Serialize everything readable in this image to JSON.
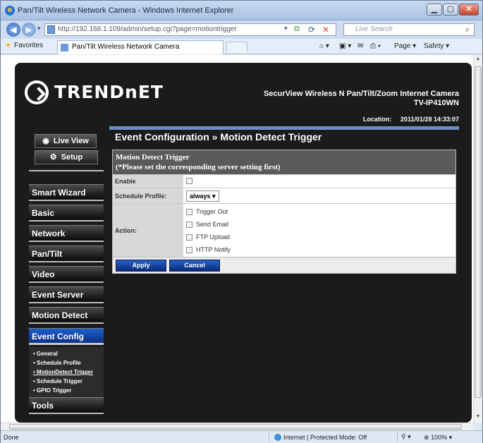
{
  "window": {
    "title": "Pan/Tilt Wireless Network Camera - Windows Internet Explorer",
    "minimize": "▁",
    "maximize": "▢",
    "close": "✕"
  },
  "addressbar": {
    "url": "http://192.168.1.109/admin/setup.cgi?page=motiontrigger",
    "search_placeholder": "Live Search"
  },
  "favorites": {
    "label": "Favorites",
    "tab_title": "Pan/Tilt Wireless Network Camera",
    "page_label": "Page ▾",
    "safety_label": "Safety ▾"
  },
  "header": {
    "brand": "TRENDnET",
    "product_line1": "SecurView Wireless N Pan/Tilt/Zoom Internet Camera",
    "product_line2": "TV-IP410WN",
    "location_label": "Location:",
    "datetime": "2011/01/28 14:33:07"
  },
  "topbuttons": {
    "live_view": "Live View",
    "setup": "Setup"
  },
  "nav": {
    "items": [
      {
        "label": "Smart Wizard"
      },
      {
        "label": "Basic"
      },
      {
        "label": "Network"
      },
      {
        "label": "Pan/Tilt"
      },
      {
        "label": "Video"
      },
      {
        "label": "Event Server"
      },
      {
        "label": "Motion Detect"
      },
      {
        "label": "Event Config"
      },
      {
        "label": "Tools"
      }
    ],
    "submenu": [
      {
        "label": "• General"
      },
      {
        "label": "• Schedule Profile"
      },
      {
        "label": "• MotionDetect Trigger"
      },
      {
        "label": "• Schedule Trigger"
      },
      {
        "label": "• GPIO Trigger"
      }
    ]
  },
  "main": {
    "heading": "Event Configuration » Motion Detect Trigger",
    "form_title_1": "Motion Detect Trigger",
    "form_title_2": "(*Please set the corresponding server setting first)",
    "enable_label": "Enable",
    "schedule_label": "Schedule Profile:",
    "schedule_value": "always",
    "action_label": "Action:",
    "actions": [
      {
        "label": "Trigger Out"
      },
      {
        "label": "Send Email"
      },
      {
        "label": "FTP Upload"
      },
      {
        "label": "HTTP Notify"
      }
    ],
    "apply": "Apply",
    "cancel": "Cancel"
  },
  "status": {
    "left": "Done",
    "zone": "Internet | Protected Mode: Off",
    "zoom": "100%"
  }
}
